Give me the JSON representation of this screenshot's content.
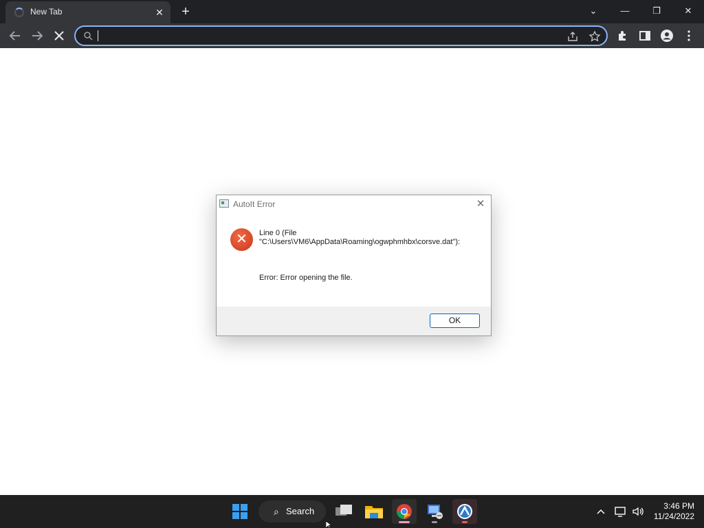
{
  "browser": {
    "tab_title": "New Tab",
    "tab_close_glyph": "✕",
    "new_tab_glyph": "+",
    "window_controls": [
      "⌄",
      "—",
      "❐",
      "✕"
    ],
    "omnibox_value": "",
    "icons": [
      "back-icon",
      "forward-icon",
      "stop-icon",
      "search-icon",
      "share-icon",
      "star-icon",
      "extensions-icon",
      "side-panel-icon",
      "profile-icon",
      "menu-icon"
    ]
  },
  "dialog": {
    "title": "AutoIt Error",
    "message_line1": "Line 0  (File",
    "message_line2": "\"C:\\Users\\VM6\\AppData\\Roaming\\ogwphmhbx\\corsve.dat\"):",
    "error_text": "Error: Error opening the file.",
    "ok_label": "OK",
    "icon": "error-icon"
  },
  "taskbar": {
    "search_label": "Search",
    "time": "3:46 PM",
    "date": "11/24/2022",
    "apps": [
      "start-icon",
      "task-view-icon",
      "file-explorer-icon",
      "chrome-icon",
      "network-tool-icon",
      "autoit-icon"
    ]
  }
}
